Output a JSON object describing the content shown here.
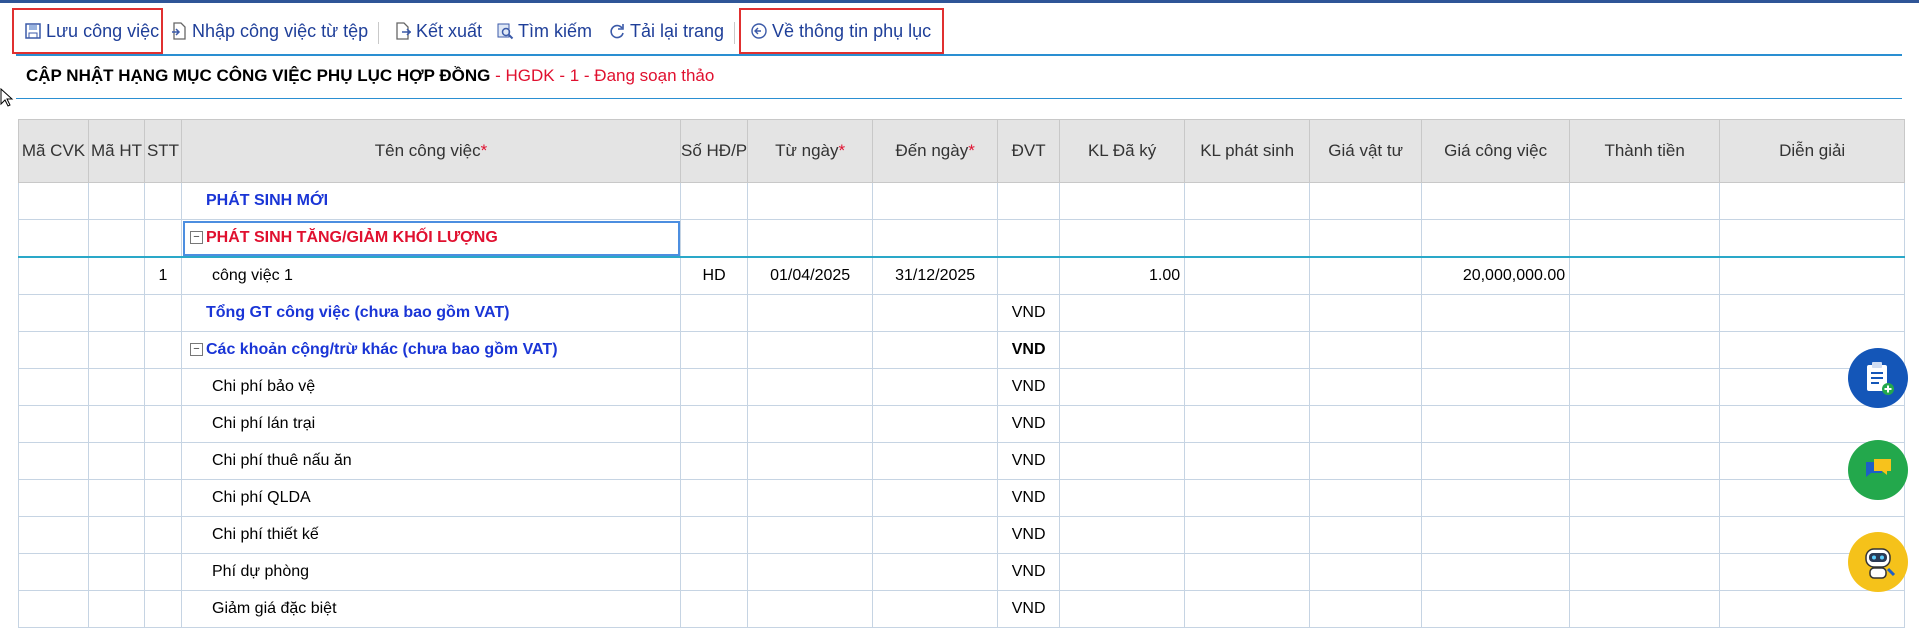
{
  "toolbar": {
    "save_label": "Lưu công việc",
    "import_label": "Nhập công việc từ tệp",
    "export_label": "Kết xuất",
    "search_label": "Tìm kiếm",
    "reload_label": "Tải lại trang",
    "back_label": "Về thông tin phụ lục"
  },
  "page": {
    "title": "CẬP NHẬT HẠNG MỤC CÔNG VIỆC PHỤ LỤC HỢP ĐỒNG",
    "subtitle": " - HGDK - 1 - Đang soạn thảo"
  },
  "table": {
    "headers": {
      "ma_cvk": "Mã CVK",
      "ma_ht": "Mã HT",
      "stt": "STT",
      "ten_cv": "Tên công việc",
      "so_hd": "Số HĐ/P",
      "tu_ngay": "Từ ngày",
      "den_ngay": "Đến ngày",
      "dvt": "ĐVT",
      "kl_da_ky": "KL Đã ký",
      "kl_phat_sinh": "KL phát sinh",
      "gia_vat_tu": "Giá vật tư",
      "gia_cong_viec": "Giá công việc",
      "thanh_tien": "Thành tiền",
      "dien_giai": "Diễn giải",
      "required_mark": "*"
    },
    "group_new": "PHÁT SINH MỚI",
    "group_change": "PHÁT SINH TĂNG/GIẢM KHỐI LƯỢNG",
    "item1": {
      "stt": "1",
      "name": "công việc 1",
      "so_hd": "HD",
      "tu_ngay": "01/04/2025",
      "den_ngay": "31/12/2025",
      "kl_da_ky": "1.00",
      "gia_cong_viec": "20,000,000.00"
    },
    "total_label": "Tổng GT công việc (chưa bao gồm VAT)",
    "total_unit": "VND",
    "other_label": "Các khoản cộng/trừ khác (chưa bao gồm VAT)",
    "other_unit": "VND",
    "costs": [
      {
        "name": "Chi phí bảo vệ",
        "unit": "VND"
      },
      {
        "name": "Chi phí lán trại",
        "unit": "VND"
      },
      {
        "name": "Chi phí thuê nấu ăn",
        "unit": "VND"
      },
      {
        "name": "Chi phí QLDA",
        "unit": "VND"
      },
      {
        "name": "Chi phí thiết kế",
        "unit": "VND"
      },
      {
        "name": "Phí dự phòng",
        "unit": "VND"
      },
      {
        "name": "Giảm giá đặc biệt",
        "unit": "VND"
      }
    ],
    "collapse_symbol": "−"
  },
  "colors": {
    "accent": "#1f3f99",
    "highlight": "#e03030",
    "group_blue": "#1a35d6",
    "group_red": "#e0102f"
  },
  "icons": [
    "save-icon",
    "import-icon",
    "export-icon",
    "search-icon",
    "reload-icon",
    "back-circle-icon",
    "clipboard-add-icon",
    "chat-icon",
    "robot-support-icon"
  ]
}
